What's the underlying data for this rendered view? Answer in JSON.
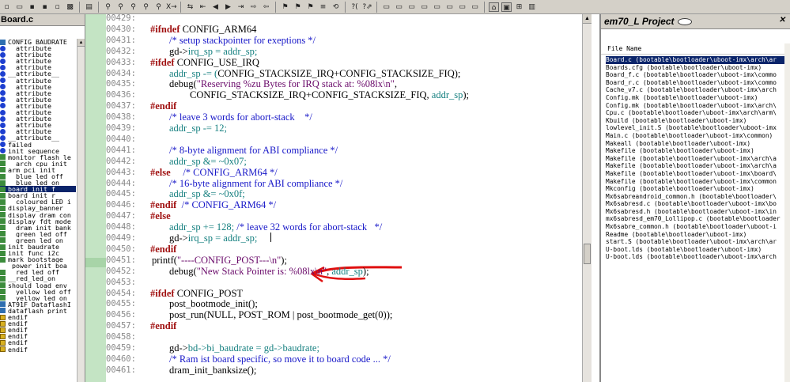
{
  "left_panel": {
    "title": "Board.c",
    "symbols": [
      {
        "label": "CONFIG_BAUDRATE",
        "icon": "grid-icon"
      },
      {
        "label": "__attribute__",
        "icon": "blue-dot-icon"
      },
      {
        "label": "__attribute__",
        "icon": "blue-dot-icon"
      },
      {
        "label": "__attribute__",
        "icon": "blue-dot-icon"
      },
      {
        "label": "__attribute__",
        "icon": "blue-dot-icon"
      },
      {
        "label": "__attribute__",
        "icon": "blue-dot-icon"
      },
      {
        "label": "__attribute__",
        "icon": "blue-dot-icon"
      },
      {
        "label": "__attribute__",
        "icon": "blue-dot-icon"
      },
      {
        "label": "__attribute__",
        "icon": "blue-dot-icon"
      },
      {
        "label": "__attribute__",
        "icon": "blue-dot-icon"
      },
      {
        "label": "__attribute__",
        "icon": "blue-dot-icon"
      },
      {
        "label": "__attribute__",
        "icon": "blue-dot-icon"
      },
      {
        "label": "__attribute__",
        "icon": "blue-dot-icon"
      },
      {
        "label": "__attribute__",
        "icon": "blue-dot-icon"
      },
      {
        "label": "__attribute__",
        "icon": "blue-dot-icon"
      },
      {
        "label": "__attribute__",
        "icon": "blue-dot-icon"
      },
      {
        "label": "failed",
        "icon": "blue-dot-icon"
      },
      {
        "label": "init_sequence",
        "icon": "blue-dot-icon"
      },
      {
        "label": "monitor_flash_le",
        "icon": "function-icon"
      },
      {
        "label": "__arch_cpu_init",
        "icon": "function-icon"
      },
      {
        "label": "arm_pci_init",
        "icon": "function-icon"
      },
      {
        "label": "__blue_led_off",
        "icon": "function-icon"
      },
      {
        "label": "__blue_led_on",
        "icon": "function-icon"
      },
      {
        "label": "board_init_f",
        "icon": "function-icon",
        "selected": true
      },
      {
        "label": "board_init_r",
        "icon": "function-icon"
      },
      {
        "label": "__coloured_LED_i",
        "icon": "function-icon"
      },
      {
        "label": "display_banner",
        "icon": "function-icon"
      },
      {
        "label": "display_dram_con",
        "icon": "function-icon"
      },
      {
        "label": "display_fdt_mode",
        "icon": "function-icon"
      },
      {
        "label": "__dram_init_bank",
        "icon": "function-icon"
      },
      {
        "label": "__green_led_off",
        "icon": "function-icon"
      },
      {
        "label": "__green_led_on",
        "icon": "function-icon"
      },
      {
        "label": "init_baudrate",
        "icon": "function-icon"
      },
      {
        "label": "init_func_i2c",
        "icon": "function-icon"
      },
      {
        "label": "mark_bootstage",
        "icon": "function-icon"
      },
      {
        "label": "power_init_boa",
        "icon": "none"
      },
      {
        "label": "__red_led_off",
        "icon": "function-icon"
      },
      {
        "label": "__red_led_on",
        "icon": "function-icon"
      },
      {
        "label": "should_load_env",
        "icon": "function-icon"
      },
      {
        "label": "__yellow_led_off",
        "icon": "function-icon"
      },
      {
        "label": "__yellow_led_on",
        "icon": "function-icon"
      },
      {
        "label": "AT91F_DataflashI",
        "icon": "cube-icon"
      },
      {
        "label": "dataflash_print_",
        "icon": "cube-icon"
      },
      {
        "label": "endif",
        "icon": "gear-icon"
      },
      {
        "label": "endif",
        "icon": "gear-icon"
      },
      {
        "label": "endif",
        "icon": "gear-icon"
      },
      {
        "label": "endif",
        "icon": "gear-icon"
      },
      {
        "label": "endif",
        "icon": "gear-icon"
      },
      {
        "label": "endif",
        "icon": "gear-icon"
      }
    ]
  },
  "editor": {
    "line_numbers": [
      "00429:",
      "00430:",
      "00431:",
      "00432:",
      "00433:",
      "00434:",
      "00435:",
      "00436:",
      "00437:",
      "00438:",
      "00439:",
      "00440:",
      "00441:",
      "00442:",
      "00443:",
      "00444:",
      "00445:",
      "00446:",
      "00447:",
      "00448:",
      "00449:",
      "00450:",
      "00451:",
      "00452:",
      "00453:",
      "00454:",
      "00455:",
      "00456:",
      "00457:",
      "00458:",
      "00459:",
      "00460:",
      "00461:"
    ],
    "lines": [
      [],
      [
        {
          "t": "#ifndef ",
          "c": "pp"
        },
        {
          "t": "CONFIG_ARM64",
          "c": "kw"
        }
      ],
      [
        {
          "t": "/* setup stackpointer for exeptions */",
          "c": "cm"
        }
      ],
      [
        {
          "t": "gd->",
          "c": "kw"
        },
        {
          "t": "irq_sp = addr_sp;",
          "c": "id"
        }
      ],
      [
        {
          "t": "#ifdef ",
          "c": "pp"
        },
        {
          "t": "CONFIG_USE_IRQ",
          "c": "kw"
        }
      ],
      [
        {
          "t": "addr_sp -= (",
          "c": "id"
        },
        {
          "t": "CONFIG_STACKSIZE_IRQ+CONFIG_STACKSIZE_FIQ);",
          "c": "kw"
        }
      ],
      [
        {
          "t": "debug(",
          "c": "kw"
        },
        {
          "t": "\"Reserving %zu Bytes for IRQ stack at: %08lx\\n\"",
          "c": "str"
        },
        {
          "t": ",",
          "c": "kw"
        }
      ],
      [
        {
          "t": "CONFIG_STACKSIZE_IRQ+CONFIG_STACKSIZE_FIQ, ",
          "c": "kw"
        },
        {
          "t": "addr_sp",
          "c": "id"
        },
        {
          "t": ");",
          "c": "kw"
        }
      ],
      [
        {
          "t": "#endif",
          "c": "pp"
        }
      ],
      [
        {
          "t": "/* leave 3 words for abort-stack    */",
          "c": "cm"
        }
      ],
      [
        {
          "t": "addr_sp -= 12;",
          "c": "id"
        }
      ],
      [],
      [
        {
          "t": "/* 8-byte alignment for ABI compliance */",
          "c": "cm"
        }
      ],
      [
        {
          "t": "addr_sp &= ~0x07;",
          "c": "id"
        }
      ],
      [
        {
          "t": "#else",
          "c": "pp"
        },
        {
          "t": "     /* CONFIG_ARM64 */",
          "c": "cm"
        }
      ],
      [
        {
          "t": "/* 16-byte alignment for ABI compliance */",
          "c": "cm"
        }
      ],
      [
        {
          "t": "addr_sp &= ~0x0f;",
          "c": "id"
        }
      ],
      [
        {
          "t": "#endif",
          "c": "pp"
        },
        {
          "t": "  /* CONFIG_ARM64 */",
          "c": "cm"
        }
      ],
      [
        {
          "t": "#else",
          "c": "pp"
        }
      ],
      [
        {
          "t": "addr_sp += 128; ",
          "c": "id"
        },
        {
          "t": "/* leave 32 words for abort-stack   */",
          "c": "cm"
        }
      ],
      [
        {
          "t": "gd->",
          "c": "kw"
        },
        {
          "t": "irq_sp = addr_sp;",
          "c": "id"
        }
      ],
      [
        {
          "t": "#endif",
          "c": "pp"
        }
      ],
      [
        {
          "t": "printf(",
          "c": "kw"
        },
        {
          "t": "\"----CONFIG_POST---\\n\"",
          "c": "str"
        },
        {
          "t": ");",
          "c": "kw"
        }
      ],
      [
        {
          "t": "debug(",
          "c": "kw"
        },
        {
          "t": "\"New Stack Pointer is: %08lx\\n\"",
          "c": "str"
        },
        {
          "t": ", ",
          "c": "kw"
        },
        {
          "t": "addr_sp",
          "c": "id"
        },
        {
          "t": ");",
          "c": "kw"
        }
      ],
      [],
      [
        {
          "t": "#ifdef ",
          "c": "pp"
        },
        {
          "t": "CONFIG_POST",
          "c": "kw"
        }
      ],
      [
        {
          "t": "post_bootmode_init();",
          "c": "kw"
        }
      ],
      [
        {
          "t": "post_run(NULL, POST_ROM | post_bootmode_get(0));",
          "c": "kw"
        }
      ],
      [
        {
          "t": "#endif",
          "c": "pp"
        }
      ],
      [],
      [
        {
          "t": "gd->",
          "c": "kw"
        },
        {
          "t": "bd->bi_baudrate = gd->baudrate;",
          "c": "id"
        }
      ],
      [
        {
          "t": "/* Ram ist board specific, so move it to board code ... */",
          "c": "cm"
        }
      ],
      [
        {
          "t": "dram_init_banksize();",
          "c": "kw"
        }
      ]
    ],
    "indents": [
      "l0",
      "l0",
      "l1",
      "l1",
      "l0",
      "l1",
      "l1",
      "l2",
      "l0",
      "l1",
      "l1",
      "l0",
      "l1",
      "l1",
      "l0",
      "l1",
      "l1",
      "l0",
      "l0",
      "l1",
      "l1",
      "l0",
      "lp",
      "l1",
      "l0",
      "l0",
      "l1",
      "l1",
      "l0",
      "l0",
      "l1",
      "l1",
      "l1"
    ]
  },
  "right_panel": {
    "title": "em70_L Project",
    "column_header": "File Name",
    "files": [
      {
        "name": "Board.c (bootable\\bootloader\\uboot-imx\\arch\\ar",
        "selected": true
      },
      {
        "name": "Boards.cfg (bootable\\bootloader\\uboot-imx)"
      },
      {
        "name": "Board_f.c (bootable\\bootloader\\uboot-imx\\commo"
      },
      {
        "name": "Board_r.c (bootable\\bootloader\\uboot-imx\\commo"
      },
      {
        "name": "Cache_v7.c (bootable\\bootloader\\uboot-imx\\arch"
      },
      {
        "name": "Config.mk (bootable\\bootloader\\uboot-imx)"
      },
      {
        "name": "Config.mk (bootable\\bootloader\\uboot-imx\\arch\\"
      },
      {
        "name": "Cpu.c (bootable\\bootloader\\uboot-imx\\arch\\arm\\"
      },
      {
        "name": "Kbuild (bootable\\bootloader\\uboot-imx)"
      },
      {
        "name": "lowlevel_init.S (bootable\\bootloader\\uboot-imx"
      },
      {
        "name": "Main.c (bootable\\bootloader\\uboot-imx\\common)"
      },
      {
        "name": "Makeall (bootable\\bootloader\\uboot-imx)"
      },
      {
        "name": "Makefile (bootable\\bootloader\\uboot-imx)"
      },
      {
        "name": "Makefile (bootable\\bootloader\\uboot-imx\\arch\\a"
      },
      {
        "name": "Makefile (bootable\\bootloader\\uboot-imx\\arch\\a"
      },
      {
        "name": "Makefile (bootable\\bootloader\\uboot-imx\\board\\"
      },
      {
        "name": "Makefile (bootable\\bootloader\\uboot-imx\\common"
      },
      {
        "name": "Mkconfig (bootable\\bootloader\\uboot-imx)"
      },
      {
        "name": "Mx6sabreandroid_common.h (bootable\\bootloader\\"
      },
      {
        "name": "Mx6sabresd.c (bootable\\bootloader\\uboot-imx\\bo"
      },
      {
        "name": "Mx6sabresd.h (bootable\\bootloader\\uboot-imx\\in"
      },
      {
        "name": "mx6sabresd_em70_Lollipop.c (bootable\\bootloader"
      },
      {
        "name": "Mx6sabre_common.h (bootable\\bootloader\\uboot-i"
      },
      {
        "name": "Readme (bootable\\bootloader\\uboot-imx)"
      },
      {
        "name": "start.S (bootable\\bootloader\\uboot-imx\\arch\\ar"
      },
      {
        "name": "U-boot.lds (bootable\\bootloader\\uboot-imx)"
      },
      {
        "name": "U-boot.lds (bootable\\bootloader\\uboot-imx\\arch"
      }
    ]
  },
  "toolbar": {
    "buttons": [
      {
        "name": "new-file-icon",
        "glyph": "▫"
      },
      {
        "name": "open-folder-icon",
        "glyph": "▭"
      },
      {
        "name": "save-icon",
        "glyph": "▪"
      },
      {
        "name": "save-all-icon",
        "glyph": "▪"
      },
      {
        "name": "close-file-icon",
        "glyph": "▫"
      },
      {
        "name": "project-icon",
        "glyph": "▩"
      },
      {
        "name": "sep"
      },
      {
        "name": "print-icon",
        "glyph": "▤"
      },
      {
        "name": "sep"
      },
      {
        "name": "find-icon",
        "glyph": "⚲"
      },
      {
        "name": "find-prev-icon",
        "glyph": "⚲"
      },
      {
        "name": "find-next-icon",
        "glyph": "⚲"
      },
      {
        "name": "find-files-icon",
        "glyph": "⚲"
      },
      {
        "name": "search-project-icon",
        "glyph": "⚲"
      },
      {
        "name": "replace-icon",
        "glyph": "X→Y"
      },
      {
        "name": "sep"
      },
      {
        "name": "toggle-marker-icon",
        "glyph": "⇆"
      },
      {
        "name": "jump-back-icon",
        "glyph": "⇤"
      },
      {
        "name": "back-icon",
        "glyph": "◀"
      },
      {
        "name": "forward-icon",
        "glyph": "▶"
      },
      {
        "name": "jump-to-def-icon",
        "glyph": "⇥"
      },
      {
        "name": "go-to-line-icon",
        "glyph": "⇨"
      },
      {
        "name": "jump-to-match-icon",
        "glyph": "⇦"
      },
      {
        "name": "sep"
      },
      {
        "name": "bookmark-icon",
        "glyph": "⚑"
      },
      {
        "name": "references-icon",
        "glyph": "⚑"
      },
      {
        "name": "call-graph-icon",
        "glyph": "⚑"
      },
      {
        "name": "symbol-info-icon",
        "glyph": "≡"
      },
      {
        "name": "sync-icon",
        "glyph": "⟲"
      },
      {
        "name": "sep"
      },
      {
        "name": "lookup-symbol-icon",
        "glyph": "?("
      },
      {
        "name": "context-help-icon",
        "glyph": "?⇗"
      },
      {
        "name": "sep"
      },
      {
        "name": "window-1-icon",
        "glyph": "▭"
      },
      {
        "name": "window-2-icon",
        "glyph": "▭"
      },
      {
        "name": "window-3-icon",
        "glyph": "▭"
      },
      {
        "name": "window-4-icon",
        "glyph": "▭"
      },
      {
        "name": "window-5-icon",
        "glyph": "▭"
      },
      {
        "name": "window-6-icon",
        "glyph": "▭"
      },
      {
        "name": "window-7-icon",
        "glyph": "▭"
      },
      {
        "name": "window-8-icon",
        "glyph": "▭"
      },
      {
        "name": "sep"
      },
      {
        "name": "symbol-window-icon",
        "glyph": "⌂",
        "pressed": true
      },
      {
        "name": "project-window-icon",
        "glyph": "▣",
        "pressed": true
      },
      {
        "name": "context-window-icon",
        "glyph": "⊞"
      },
      {
        "name": "relation-window-icon",
        "glyph": "▥"
      }
    ]
  }
}
